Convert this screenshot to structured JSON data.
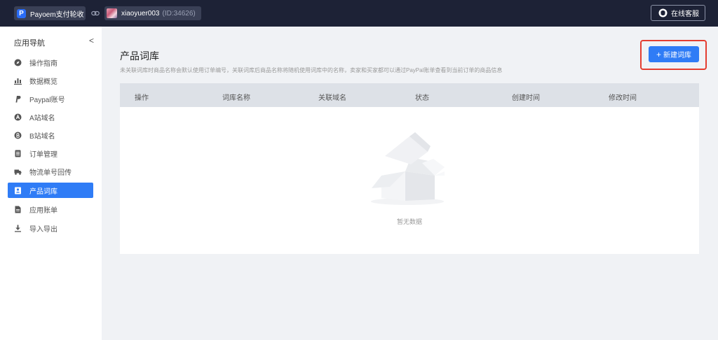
{
  "topbar": {
    "brand_logo": "P",
    "brand_name": "Payoem支付轮收",
    "username": "xiaoyuer003",
    "user_id": "(ID:34626)",
    "service_label": "在线客服"
  },
  "sidebar": {
    "title": "应用导航",
    "collapse": "<",
    "items": [
      {
        "label": "操作指南",
        "icon": "compass-icon"
      },
      {
        "label": "数据概览",
        "icon": "bar-chart-icon"
      },
      {
        "label": "Paypal账号",
        "icon": "paypal-icon"
      },
      {
        "label": "A站域名",
        "icon": "a-circle-icon"
      },
      {
        "label": "B站域名",
        "icon": "b-circle-icon"
      },
      {
        "label": "订单管理",
        "icon": "clipboard-icon"
      },
      {
        "label": "物流单号回传",
        "icon": "truck-icon"
      },
      {
        "label": "产品词库",
        "icon": "contacts-icon",
        "active": true
      },
      {
        "label": "应用账单",
        "icon": "document-icon"
      },
      {
        "label": "导入导出",
        "icon": "download-icon"
      }
    ]
  },
  "main": {
    "title": "产品词库",
    "description": "未关联词库时商品名称会默认使用订单编号，关联词库后商品名称将随机使用词库中的名称，卖家和买家都可以通过PayPal账单查看到当前订单的商品信息",
    "new_button": "新建词库",
    "new_button_plus": "+",
    "table": {
      "columns": [
        "操作",
        "词库名称",
        "关联域名",
        "状态",
        "创建时间",
        "修改时间"
      ],
      "rows": [],
      "empty_text": "暂无数据"
    }
  },
  "colors": {
    "topbar": "#1d2236",
    "accent": "#2f7cf6",
    "highlight_frame": "#e43d30"
  }
}
